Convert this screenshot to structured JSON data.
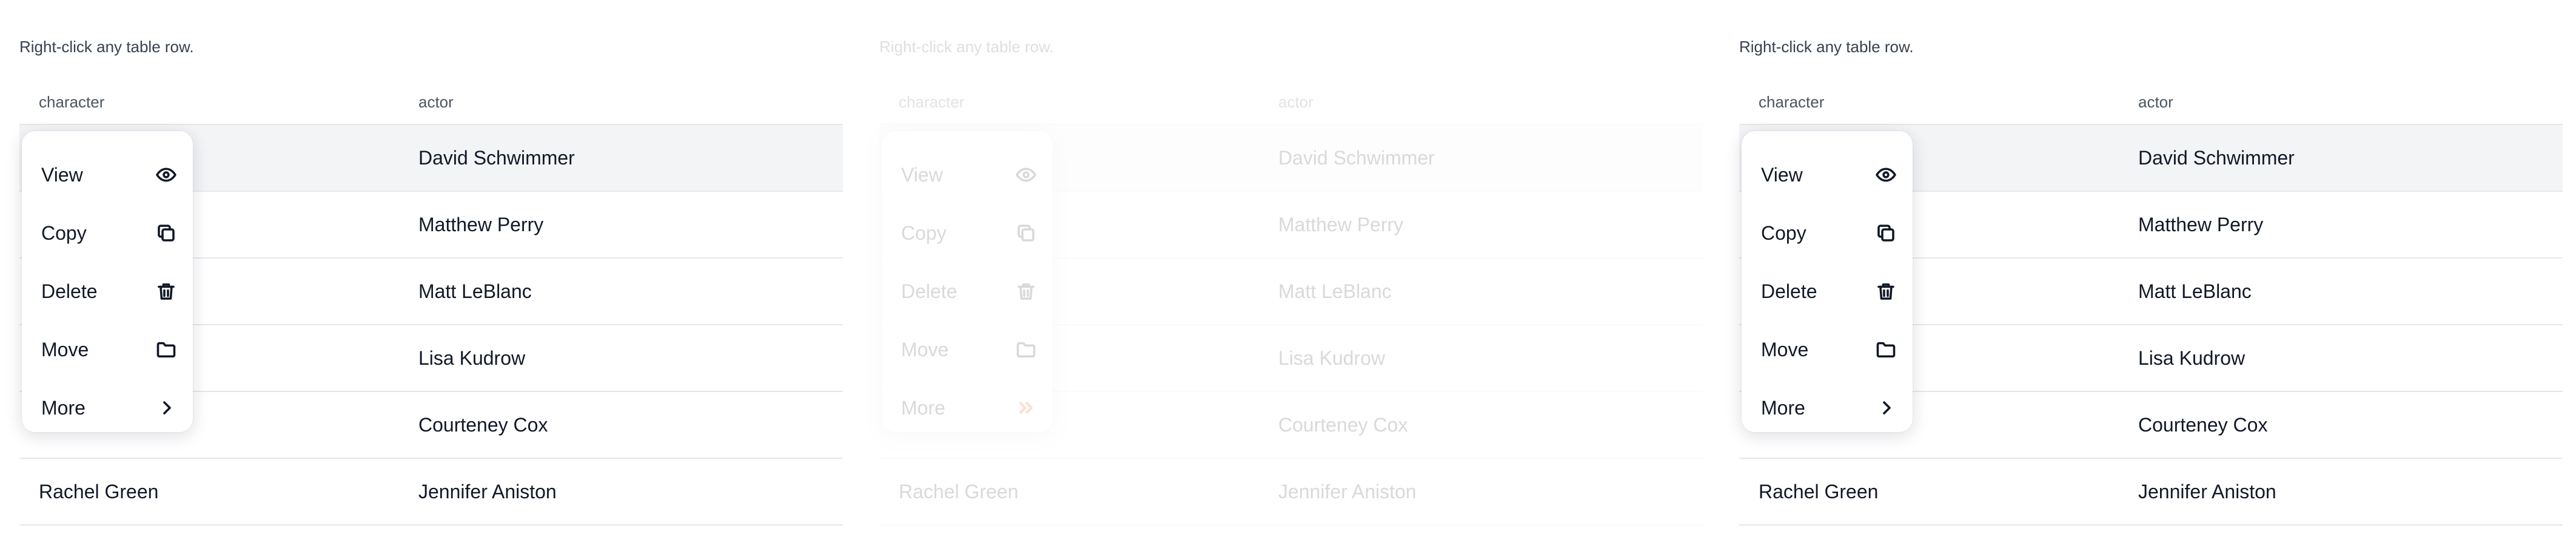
{
  "hint": "Right-click any table row.",
  "columns": [
    "character",
    "actor"
  ],
  "rows": [
    {
      "character": "",
      "actor": "David Schwimmer"
    },
    {
      "character": "",
      "actor": "Matthew Perry"
    },
    {
      "character": "",
      "actor": "Matt LeBlanc"
    },
    {
      "character": "",
      "actor": "Lisa Kudrow"
    },
    {
      "character": "",
      "actor": "Courteney Cox"
    },
    {
      "character": "Rachel Green",
      "actor": "Jennifer Aniston"
    }
  ],
  "menu": {
    "items": [
      {
        "label": "View",
        "icon": "eye-icon"
      },
      {
        "label": "Copy",
        "icon": "copy-icon"
      },
      {
        "label": "Delete",
        "icon": "trash-icon"
      },
      {
        "label": "Move",
        "icon": "folder-icon"
      },
      {
        "label": "More",
        "icon": "chevron-right-icon"
      }
    ]
  },
  "colors": {
    "accent": "#e5480e",
    "row_highlight": "#f3f4f6",
    "border": "#e5e7eb"
  }
}
